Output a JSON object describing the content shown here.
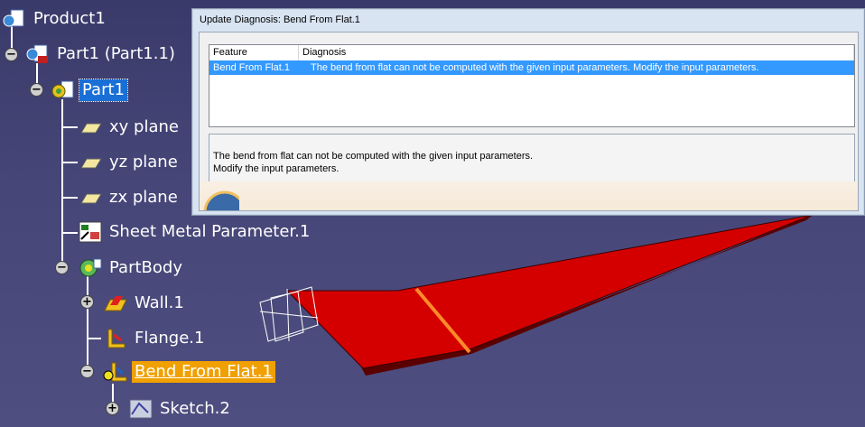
{
  "tree": {
    "nodes": [
      {
        "label": "Product1",
        "icon": "product-icon"
      },
      {
        "label": "Part1 (Part1.1)",
        "icon": "part-instance-icon"
      },
      {
        "label": "Part1",
        "icon": "part-icon"
      },
      {
        "label": "xy plane",
        "icon": "plane-icon"
      },
      {
        "label": "yz plane",
        "icon": "plane-icon"
      },
      {
        "label": "zx plane",
        "icon": "plane-icon"
      },
      {
        "label": "Sheet Metal Parameter.1",
        "icon": "sheet-metal-parameter-icon"
      },
      {
        "label": "PartBody",
        "icon": "partbody-icon"
      },
      {
        "label": "Wall.1",
        "icon": "wall-icon"
      },
      {
        "label": "Flange.1",
        "icon": "flange-icon"
      },
      {
        "label": "Bend From Flat.1",
        "icon": "bend-from-flat-icon"
      },
      {
        "label": "Sketch.2",
        "icon": "sketch-icon"
      }
    ]
  },
  "dialog": {
    "title": "Update Diagnosis: Bend From Flat.1",
    "columns": [
      "Feature",
      "Diagnosis"
    ],
    "rows": [
      {
        "feature": "Bend From Flat.1",
        "diagnosis": "The bend from flat can not be computed with the given input parameters. Modify the input parameters."
      }
    ],
    "detail_line1": "The bend from flat can not be computed with the given input parameters.",
    "detail_line2": "Modify the input parameters."
  },
  "colors": {
    "background": "#464678",
    "selection": "#1a6fd6",
    "highlight": "#f0a000",
    "part_red": "#d40000"
  }
}
